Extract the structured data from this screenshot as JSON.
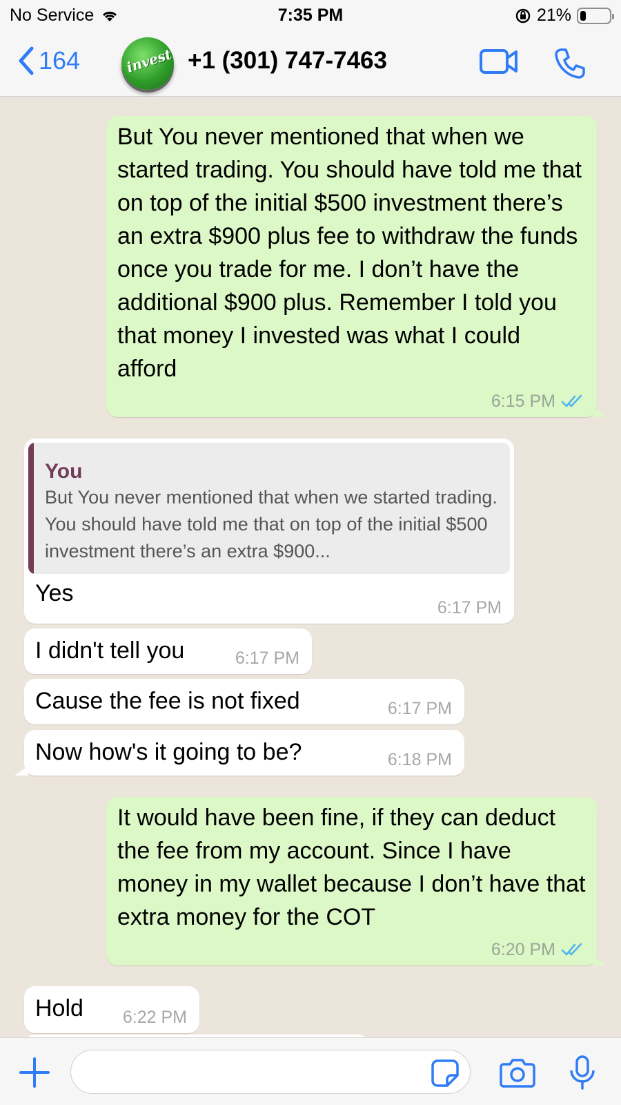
{
  "status_bar": {
    "carrier": "No Service",
    "time": "7:35 PM",
    "battery_percent": "21%",
    "battery_level": 0.21
  },
  "header": {
    "back_count": "164",
    "avatar_text": "invest",
    "contact": "+1 (301) 747-7463"
  },
  "messages": [
    {
      "direction": "outgoing",
      "text": "But You never mentioned that when we started trading. You should have told me that on top of the initial $500 investment there’s an extra $900 plus fee to withdraw the funds once you trade for me. I don’t have the additional $900 plus. Remember I told you that money I invested was what I could afford",
      "time": "6:15 PM",
      "read": true
    },
    {
      "direction": "incoming",
      "quote_author": "You",
      "quote_text": "But You never mentioned that when we started trading. You should have told me that on top of the initial $500 investment there’s an extra $900...",
      "text": "Yes",
      "time": "6:17 PM"
    },
    {
      "direction": "incoming",
      "text": "I didn't tell you",
      "time": "6:17 PM"
    },
    {
      "direction": "incoming",
      "text": "Cause the fee is not fixed",
      "time": "6:17 PM"
    },
    {
      "direction": "incoming",
      "text": "Now how's it going to be?",
      "time": "6:18 PM"
    },
    {
      "direction": "outgoing",
      "text": "It would have been fine, if they can deduct the fee from my account. Since I have money in my wallet because I don’t have that extra money for the COT",
      "time": "6:20 PM",
      "read": true
    },
    {
      "direction": "incoming",
      "text": "Hold",
      "time": "6:22 PM"
    }
  ],
  "icons": {
    "wifi": "wifi-icon",
    "orientation_lock": "orientation-lock-icon",
    "back": "chevron-left-icon",
    "video": "video-camera-icon",
    "phone": "phone-icon",
    "read": "double-check-icon",
    "plus": "plus-icon",
    "sticker": "sticker-icon",
    "camera": "camera-icon",
    "mic": "microphone-icon"
  },
  "colors": {
    "accent": "#2f7cf6",
    "outgoing_bubble": "#dcf8c6",
    "incoming_bubble": "#ffffff",
    "quote_author": "#733d57",
    "read_ticks": "#4fb3f0"
  }
}
